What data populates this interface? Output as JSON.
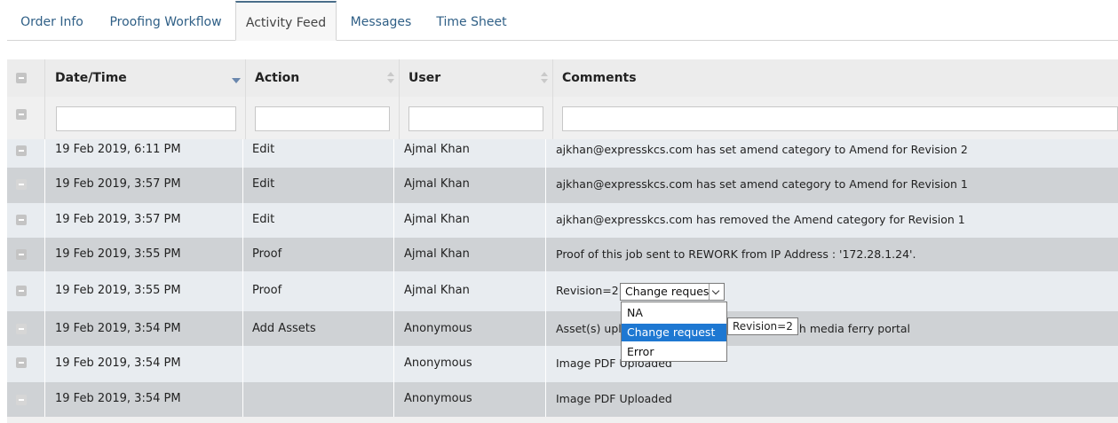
{
  "tabs": [
    {
      "label": "Order Info"
    },
    {
      "label": "Proofing Workflow"
    },
    {
      "label": "Activity Feed",
      "active": true
    },
    {
      "label": "Messages"
    },
    {
      "label": "Time Sheet"
    }
  ],
  "table": {
    "columns": [
      "Date/Time",
      "Action",
      "User",
      "Comments"
    ],
    "sort": {
      "column": "Date/Time",
      "direction": "descending"
    },
    "rows": [
      {
        "datetime": "19 Feb 2019, 6:11 PM",
        "action": "Edit",
        "user": "Ajmal Khan",
        "comment": "ajkhan@expresskcs.com has set amend category to Amend for Revision 2"
      },
      {
        "datetime": "19 Feb 2019, 3:57 PM",
        "action": "Edit",
        "user": "Ajmal Khan",
        "comment": "ajkhan@expresskcs.com has set amend category to Amend for Revision 1"
      },
      {
        "datetime": "19 Feb 2019, 3:57 PM",
        "action": "Edit",
        "user": "Ajmal Khan",
        "comment": "ajkhan@expresskcs.com has removed the Amend category for Revision 1"
      },
      {
        "datetime": "19 Feb 2019, 3:55 PM",
        "action": "Proof",
        "user": "Ajmal Khan",
        "comment": "Proof of this job sent to REWORK from IP Address : '172.28.1.24'."
      },
      {
        "datetime": "19 Feb 2019, 3:55 PM",
        "action": "Proof",
        "user": "Ajmal Khan",
        "comment": "Revision=2"
      },
      {
        "datetime": "19 Feb 2019, 3:54 PM",
        "action": "Add Assets",
        "user": "Anonymous",
        "comment": "Asset(s) uploaded through media ferry portal",
        "comment_head": "Asset(s) uplo",
        "comment_tail": "gh media ferry portal"
      },
      {
        "datetime": "19 Feb 2019, 3:54 PM",
        "action": "",
        "user": "Anonymous",
        "comment": "Image PDF Uploaded"
      },
      {
        "datetime": "19 Feb 2019, 3:54 PM",
        "action": "",
        "user": "Anonymous",
        "comment": "Image PDF Uploaded"
      }
    ]
  },
  "category_select": {
    "selected": "Change request",
    "options": [
      "NA",
      "Change request",
      "Error"
    ],
    "highlighted": "Change request",
    "tooltip": "Revision=2"
  },
  "colors": {
    "tab_text": "#2f5f86",
    "row_light": "#e8ecf0",
    "row_dark": "#cfd2d5",
    "highlight": "#1e78d2",
    "sort_arrow": "#6a87ad"
  }
}
